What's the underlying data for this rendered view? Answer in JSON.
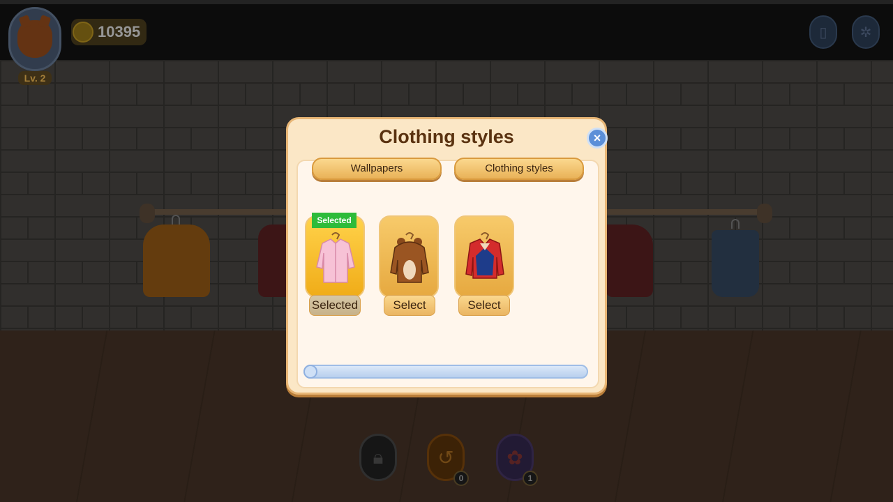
{
  "hud": {
    "level": "Lv. 2",
    "coins": "10395"
  },
  "modal": {
    "title": "Clothing styles",
    "tabs": [
      {
        "label": "Wallpapers",
        "active": false
      },
      {
        "label": "Clothing styles",
        "active": true
      }
    ],
    "items": [
      {
        "icon": "pink-shirt-icon",
        "tag": "Selected",
        "button": "Selected"
      },
      {
        "icon": "bear-hoodie-icon",
        "button": "Select"
      },
      {
        "icon": "red-blue-jacket-icon",
        "button": "Select"
      }
    ],
    "scroll_progress": 0
  },
  "tools": {
    "undo_count": "0",
    "wheel_count": "1"
  },
  "colors": {
    "accent": "#e9b258",
    "selected_tag": "#2dbb3a",
    "close_button": "#5b8fd8"
  }
}
